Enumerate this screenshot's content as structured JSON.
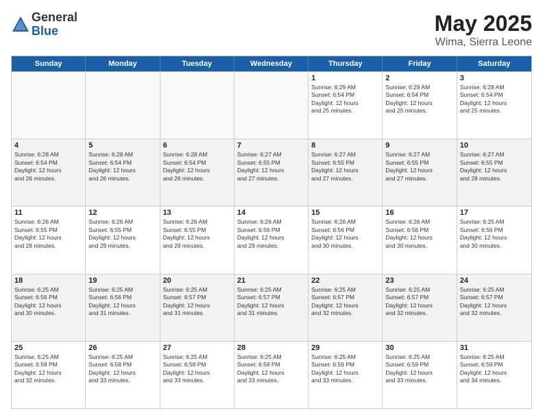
{
  "logo": {
    "general": "General",
    "blue": "Blue"
  },
  "title": {
    "month": "May 2025",
    "location": "Wima, Sierra Leone"
  },
  "days": [
    "Sunday",
    "Monday",
    "Tuesday",
    "Wednesday",
    "Thursday",
    "Friday",
    "Saturday"
  ],
  "weeks": [
    [
      {
        "date": "",
        "info": "",
        "empty": true
      },
      {
        "date": "",
        "info": "",
        "empty": true
      },
      {
        "date": "",
        "info": "",
        "empty": true
      },
      {
        "date": "",
        "info": "",
        "empty": true
      },
      {
        "date": "1",
        "info": "Sunrise: 6:29 AM\nSunset: 6:54 PM\nDaylight: 12 hours\nand 25 minutes."
      },
      {
        "date": "2",
        "info": "Sunrise: 6:29 AM\nSunset: 6:54 PM\nDaylight: 12 hours\nand 25 minutes."
      },
      {
        "date": "3",
        "info": "Sunrise: 6:28 AM\nSunset: 6:54 PM\nDaylight: 12 hours\nand 25 minutes."
      }
    ],
    [
      {
        "date": "4",
        "info": "Sunrise: 6:28 AM\nSunset: 6:54 PM\nDaylight: 12 hours\nand 26 minutes."
      },
      {
        "date": "5",
        "info": "Sunrise: 6:28 AM\nSunset: 6:54 PM\nDaylight: 12 hours\nand 26 minutes."
      },
      {
        "date": "6",
        "info": "Sunrise: 6:28 AM\nSunset: 6:54 PM\nDaylight: 12 hours\nand 26 minutes."
      },
      {
        "date": "7",
        "info": "Sunrise: 6:27 AM\nSunset: 6:55 PM\nDaylight: 12 hours\nand 27 minutes."
      },
      {
        "date": "8",
        "info": "Sunrise: 6:27 AM\nSunset: 6:55 PM\nDaylight: 12 hours\nand 27 minutes."
      },
      {
        "date": "9",
        "info": "Sunrise: 6:27 AM\nSunset: 6:55 PM\nDaylight: 12 hours\nand 27 minutes."
      },
      {
        "date": "10",
        "info": "Sunrise: 6:27 AM\nSunset: 6:55 PM\nDaylight: 12 hours\nand 28 minutes."
      }
    ],
    [
      {
        "date": "11",
        "info": "Sunrise: 6:26 AM\nSunset: 6:55 PM\nDaylight: 12 hours\nand 28 minutes."
      },
      {
        "date": "12",
        "info": "Sunrise: 6:26 AM\nSunset: 6:55 PM\nDaylight: 12 hours\nand 29 minutes."
      },
      {
        "date": "13",
        "info": "Sunrise: 6:26 AM\nSunset: 6:55 PM\nDaylight: 12 hours\nand 29 minutes."
      },
      {
        "date": "14",
        "info": "Sunrise: 6:26 AM\nSunset: 6:56 PM\nDaylight: 12 hours\nand 29 minutes."
      },
      {
        "date": "15",
        "info": "Sunrise: 6:26 AM\nSunset: 6:56 PM\nDaylight: 12 hours\nand 30 minutes."
      },
      {
        "date": "16",
        "info": "Sunrise: 6:26 AM\nSunset: 6:56 PM\nDaylight: 12 hours\nand 30 minutes."
      },
      {
        "date": "17",
        "info": "Sunrise: 6:25 AM\nSunset: 6:56 PM\nDaylight: 12 hours\nand 30 minutes."
      }
    ],
    [
      {
        "date": "18",
        "info": "Sunrise: 6:25 AM\nSunset: 6:56 PM\nDaylight: 12 hours\nand 30 minutes."
      },
      {
        "date": "19",
        "info": "Sunrise: 6:25 AM\nSunset: 6:56 PM\nDaylight: 12 hours\nand 31 minutes."
      },
      {
        "date": "20",
        "info": "Sunrise: 6:25 AM\nSunset: 6:57 PM\nDaylight: 12 hours\nand 31 minutes."
      },
      {
        "date": "21",
        "info": "Sunrise: 6:25 AM\nSunset: 6:57 PM\nDaylight: 12 hours\nand 31 minutes."
      },
      {
        "date": "22",
        "info": "Sunrise: 6:25 AM\nSunset: 6:57 PM\nDaylight: 12 hours\nand 32 minutes."
      },
      {
        "date": "23",
        "info": "Sunrise: 6:25 AM\nSunset: 6:57 PM\nDaylight: 12 hours\nand 32 minutes."
      },
      {
        "date": "24",
        "info": "Sunrise: 6:25 AM\nSunset: 6:57 PM\nDaylight: 12 hours\nand 32 minutes."
      }
    ],
    [
      {
        "date": "25",
        "info": "Sunrise: 6:25 AM\nSunset: 6:58 PM\nDaylight: 12 hours\nand 32 minutes."
      },
      {
        "date": "26",
        "info": "Sunrise: 6:25 AM\nSunset: 6:58 PM\nDaylight: 12 hours\nand 33 minutes."
      },
      {
        "date": "27",
        "info": "Sunrise: 6:25 AM\nSunset: 6:58 PM\nDaylight: 12 hours\nand 33 minutes."
      },
      {
        "date": "28",
        "info": "Sunrise: 6:25 AM\nSunset: 6:58 PM\nDaylight: 12 hours\nand 33 minutes."
      },
      {
        "date": "29",
        "info": "Sunrise: 6:25 AM\nSunset: 6:59 PM\nDaylight: 12 hours\nand 33 minutes."
      },
      {
        "date": "30",
        "info": "Sunrise: 6:25 AM\nSunset: 6:59 PM\nDaylight: 12 hours\nand 33 minutes."
      },
      {
        "date": "31",
        "info": "Sunrise: 6:25 AM\nSunset: 6:59 PM\nDaylight: 12 hours\nand 34 minutes."
      }
    ]
  ]
}
